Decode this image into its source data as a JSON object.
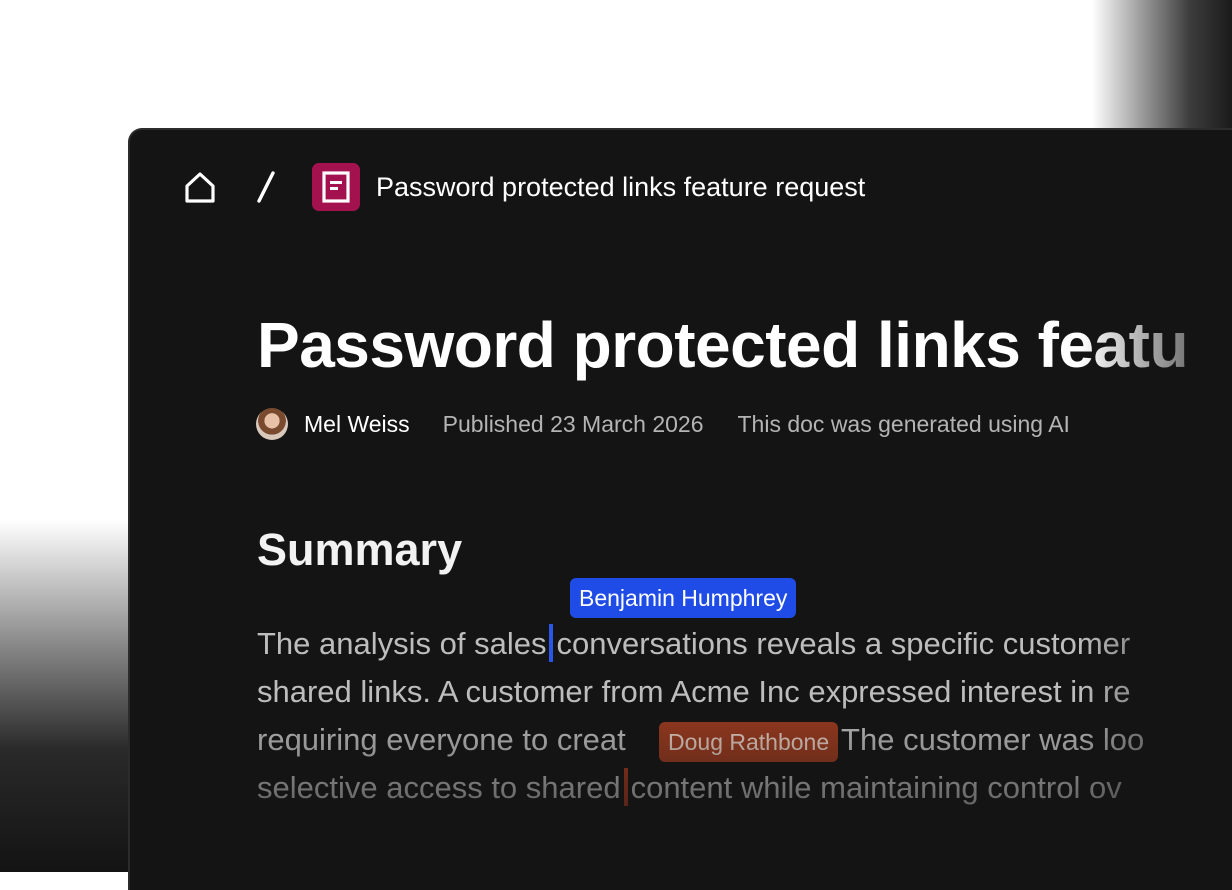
{
  "breadcrumb": {
    "home_icon": "home-icon",
    "separator": "/",
    "doc_icon": "document-icon",
    "doc_icon_color": "#a3124e",
    "title": "Password protected links feature request"
  },
  "document": {
    "title": "Password protected links featu",
    "author": "Mel Weiss",
    "published": "Published 23 March 2026",
    "ai_note": "This doc was generated using AI",
    "section_heading": "Summary",
    "paragraph_lines": [
      "The analysis of sales",
      "conversations reveals a specific customer",
      "shared links. A customer from Acme Inc expressed interest in re",
      "requiring everyone to creat",
      "t. The customer was loo",
      "selective access to shared",
      "content while maintaining control ov"
    ]
  },
  "collaborators": [
    {
      "name": "Benjamin Humphrey",
      "color": "#1f4ce6"
    },
    {
      "name": "Doug Rathbone",
      "color": "#9a3a1f"
    }
  ]
}
